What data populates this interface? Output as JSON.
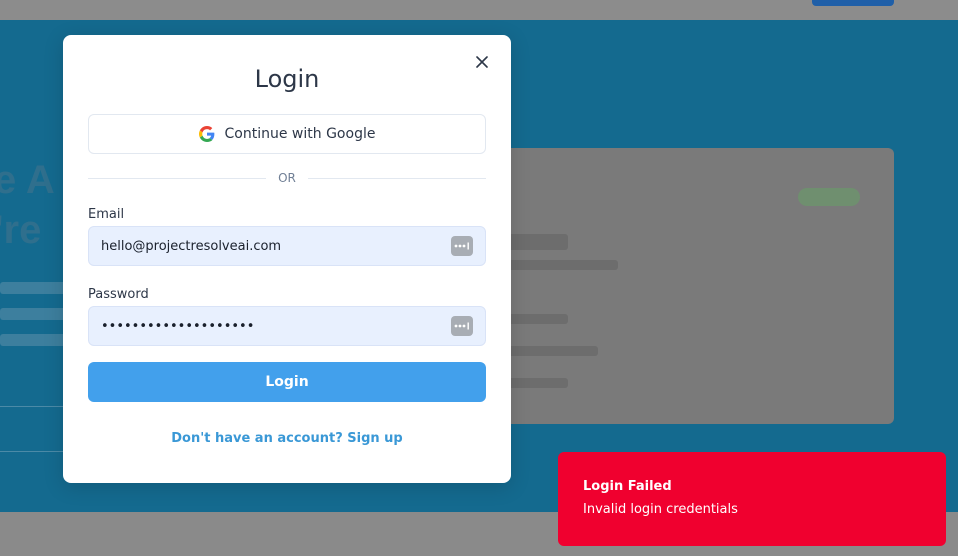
{
  "modal": {
    "title": "Login",
    "google_label": "Continue with Google",
    "divider_text": "OR",
    "email_label": "Email",
    "email_value": "hello@projectresolveai.com",
    "password_label": "Password",
    "password_mask": "••••••••••••••••••••",
    "login_label": "Login",
    "signup_text": "Don't have an account? Sign up"
  },
  "toast": {
    "title": "Login Failed",
    "message": "Invalid login credentials"
  },
  "background": {
    "heading_line1": "e A",
    "heading_line2": "'re"
  },
  "icons": {
    "close": "close-icon",
    "google": "google-logo-icon",
    "autofill": "password-manager-icon"
  },
  "colors": {
    "primary": "#42a0ec",
    "link": "#3a98d6",
    "error": "#f0002f",
    "field_bg": "#e8f0fe"
  }
}
